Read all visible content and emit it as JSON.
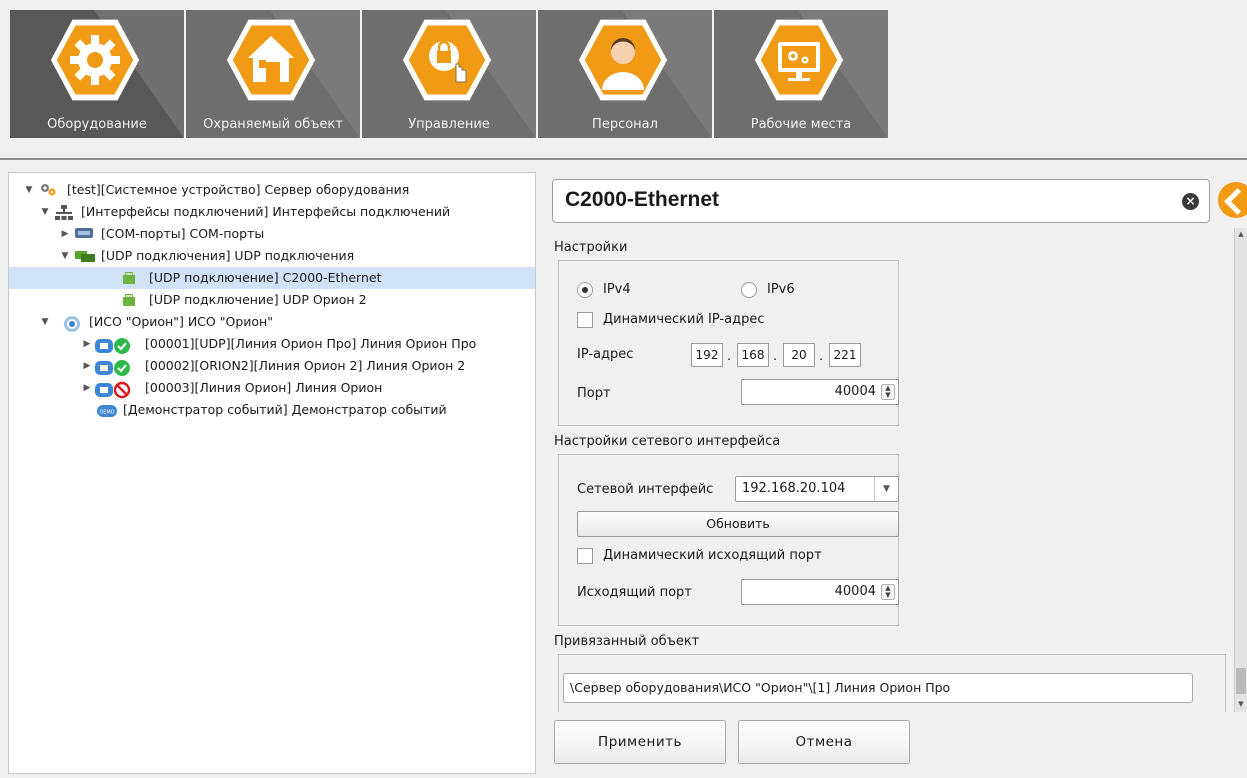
{
  "toolbar": {
    "tabs": [
      {
        "label": "Оборудование",
        "icon": "gear-icon",
        "active": true
      },
      {
        "label": "Охраняемый объект",
        "icon": "house-icon",
        "active": false
      },
      {
        "label": "Управление",
        "icon": "lock-hand-icon",
        "active": false
      },
      {
        "label": "Персонал",
        "icon": "person-icon",
        "active": false
      },
      {
        "label": "Рабочие места",
        "icon": "monitor-gears-icon",
        "active": false
      }
    ]
  },
  "tree": {
    "items": [
      {
        "text": "[test][Системное устройство] Сервер оборудования",
        "expanded": true,
        "icon": "gears-icon"
      },
      {
        "text": "[Интерфейсы подключений] Интерфейсы подключений",
        "expanded": true,
        "icon": "network-icon"
      },
      {
        "text": "[COM-порты] COM-порты",
        "expanded": false,
        "icon": "com-port-icon"
      },
      {
        "text": "[UDP подключения] UDP подключения",
        "expanded": true,
        "icon": "udp-group-icon"
      },
      {
        "text": "[UDP подключение] C2000-Ethernet",
        "selected": true,
        "icon": "udp-connector-icon"
      },
      {
        "text": "[UDP подключение] UDP Орион 2",
        "icon": "udp-connector-icon"
      },
      {
        "text": "[ИСО \"Орион\"] ИСО \"Орион\"",
        "expanded": true,
        "icon": "iso-orion-icon"
      },
      {
        "text": "[00001][UDP][Линия Орион Про] Линия Орион Про",
        "expanded": false,
        "icon": "line-ok-icon"
      },
      {
        "text": "[00002][ORION2][Линия Орион 2] Линия Орион 2",
        "expanded": false,
        "icon": "line-ok-icon"
      },
      {
        "text": "[00003][Линия Орион] Линия Орион",
        "expanded": false,
        "icon": "line-disabled-icon"
      },
      {
        "text": "[Демонстратор событий] Демонстратор событий",
        "icon": "demo-icon",
        "badge": "DEMO"
      }
    ]
  },
  "panel": {
    "title": "C2000-Ethernet",
    "settings": {
      "section_label": "Настройки",
      "ipv4_label": "IPv4",
      "ipv6_label": "IPv6",
      "ipv4_selected": true,
      "dynamic_ip_label": "Динамический IP-адрес",
      "dynamic_ip_checked": false,
      "ip_label": "IP-адрес",
      "ip_octets": [
        "192",
        "168",
        "20",
        "221"
      ],
      "port_label": "Порт",
      "port_value": "40004"
    },
    "net": {
      "section_label": "Настройки сетевого интерфейса",
      "iface_label": "Сетевой интерфейс",
      "iface_value": "192.168.20.104",
      "refresh_label": "Обновить",
      "dynamic_out_label": "Динамический исходящий порт",
      "dynamic_out_checked": false,
      "out_port_label": "Исходящий порт",
      "out_port_value": "40004"
    },
    "bound": {
      "section_label": "Привязанный объект",
      "value": "\\Сервер оборудования\\ИСО \"Орион\"\\[1] Линия Орион Про"
    },
    "apply_label": "Применить",
    "cancel_label": "Отмена"
  },
  "colors": {
    "accent": "#f19a14",
    "toolbar": "#6e6e6e",
    "selection": "#cfe2f7",
    "ok": "#2fb84a",
    "error": "#e0161b",
    "device_blue": "#3d86d6"
  }
}
